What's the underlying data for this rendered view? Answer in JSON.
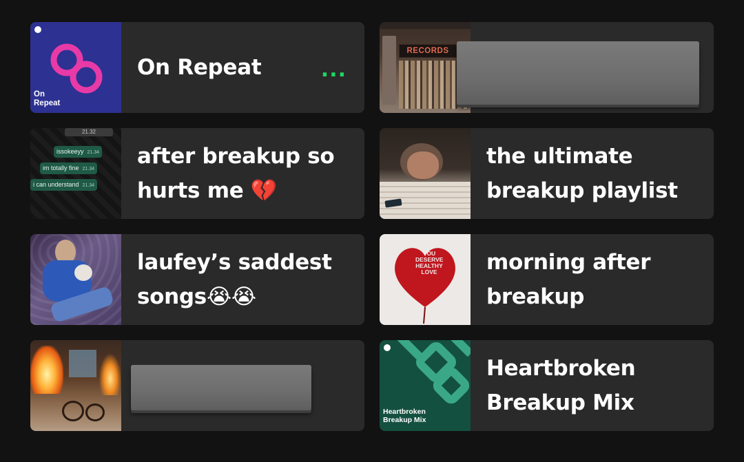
{
  "playlists": [
    {
      "title_lines": [
        "On Repeat"
      ],
      "cover_text": [
        "On",
        "Repeat"
      ],
      "more_label": "..."
    },
    {
      "title_lines": [],
      "cover_sign": "RECORDS"
    },
    {
      "title_lines": [
        "after breakup so",
        "hurts me 💔"
      ],
      "chat": {
        "time": "21.32",
        "messages": [
          {
            "text": "issokeeyy",
            "time": "21.34"
          },
          {
            "text": "im totally fine",
            "time": "21.34"
          },
          {
            "text": "i can understand",
            "time": "21.34"
          }
        ]
      }
    },
    {
      "title_lines": [
        "the ultimate",
        "breakup playlist"
      ]
    },
    {
      "title_lines": [
        "laufey’s saddest",
        "songs😭😭"
      ]
    },
    {
      "title_lines": [
        "morning after",
        "breakup"
      ],
      "balloon_text": [
        "YOU",
        "DESERVE",
        "HEALTHY",
        "LOVE"
      ]
    },
    {
      "title_lines": []
    },
    {
      "title_lines": [
        "Heartbroken",
        "Breakup Mix"
      ],
      "cover_text": [
        "Heartbroken",
        "Breakup Mix"
      ]
    }
  ],
  "colors": {
    "background": "#121212",
    "card": "#2a2a2a",
    "accent": "#1ed760",
    "on_repeat_cover": "#2d3191",
    "on_repeat_logo": "#e83aa7",
    "heartbroken_cover": "#14503f"
  },
  "icons": [
    "spotify-logo-icon",
    "more-options-icon",
    "broken-heart-emoji",
    "crying-face-emoji"
  ]
}
